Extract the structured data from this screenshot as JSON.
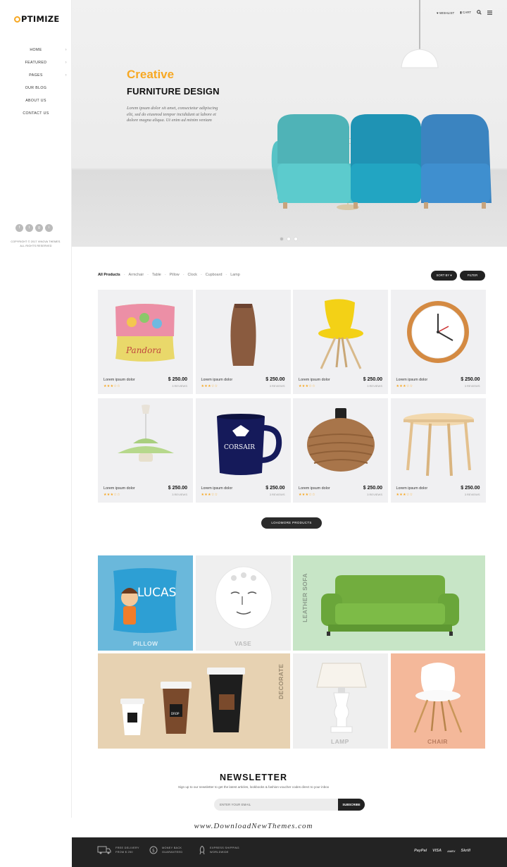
{
  "brand": {
    "logo_prefix": "",
    "logo_text": "PTIMIZE",
    "accent": "#f7a823"
  },
  "nav": {
    "items": [
      "HOME",
      "FEATURED",
      "PAGES",
      "OUR BLOG",
      "ABOUT US",
      "CONTACT US"
    ]
  },
  "social": {
    "facebook": "f",
    "twitter": "t",
    "google": "g",
    "instagram": "i"
  },
  "copyright": {
    "line1": "COPYRIGHT © 2017 VINOVA THEMES.",
    "line2": "ALL RIGHTS RESERVED"
  },
  "topbar": {
    "wishlist": "WISHLIST",
    "cart": "CART"
  },
  "hero": {
    "title1": "Creative",
    "title2": "FURNITURE DESIGN",
    "text": "Lorem ipsum dolor sit amet, consectetur adipiscing elit, sed do eiusmod tempor incididunt ut labore et dolore magna aliqua. Ut enim ad minim veniam"
  },
  "filters": {
    "items": [
      "All Products",
      "Armchair",
      "Table",
      "Pillow",
      "Clock",
      "Cupboard",
      "Lamp"
    ],
    "sort": "SORT BY",
    "filter": "FILTER"
  },
  "products": [
    {
      "name": "Lorem ipsum dolor",
      "price": "$ 250.00",
      "stars": "★★★☆☆",
      "reviews": "3 REVIEWS"
    },
    {
      "name": "Lorem ipsum dolor",
      "price": "$ 250.00",
      "stars": "★★★☆☆",
      "reviews": "3 REVIEWS"
    },
    {
      "name": "Lorem ipsum dolor",
      "price": "$ 250.00",
      "stars": "★★★☆☆",
      "reviews": "3 REVIEWS"
    },
    {
      "name": "Lorem ipsum dolor",
      "price": "$ 250.00",
      "stars": "★★★☆☆",
      "reviews": "3 REVIEWS"
    },
    {
      "name": "Lorem ipsum dolor",
      "price": "$ 250.00",
      "stars": "★★★☆☆",
      "reviews": "3 REVIEWS"
    },
    {
      "name": "Lorem ipsum dolor",
      "price": "$ 250.00",
      "stars": "★★★☆☆",
      "reviews": "3 REVIEWS"
    },
    {
      "name": "Lorem ipsum dolor",
      "price": "$ 250.00",
      "stars": "★★★☆☆",
      "reviews": "3 REVIEWS"
    },
    {
      "name": "Lorem ipsum dolor",
      "price": "$ 250.00",
      "stars": "★★★☆☆",
      "reviews": "3 REVIEWS"
    }
  ],
  "load_more": "LOADMORE PRODUCTS",
  "banners": {
    "pillow": "PILLOW",
    "vase": "VASE",
    "sofa": "LEATHER SOFA",
    "decorate": "DECORATE",
    "lamp": "LAMP",
    "chair": "CHAIR",
    "pillow_print": "LUCAS",
    "cup_print": "DROP"
  },
  "newsletter": {
    "title": "NEWSLETTER",
    "subtitle": "Sign up to our newsletter to get the latest articles, lookbooks & fashion voucher codes direct to your inbox",
    "placeholder": "ENTER YOUR EMAIL",
    "button": "SUBSCRIBE"
  },
  "watermark": "www.DownloadNewThemes.com",
  "footer": {
    "features": [
      {
        "line1": "FREE DELIVERY",
        "line2": "FROM $ 250"
      },
      {
        "line1": "MONEY BACK",
        "line2": "GUARANTEED"
      },
      {
        "line1": "EXPRESS SHIPPING",
        "line2": "WORLDWIDE"
      }
    ],
    "payments": [
      "PayPal",
      "VISA",
      "AMEX",
      "Skrill"
    ]
  }
}
